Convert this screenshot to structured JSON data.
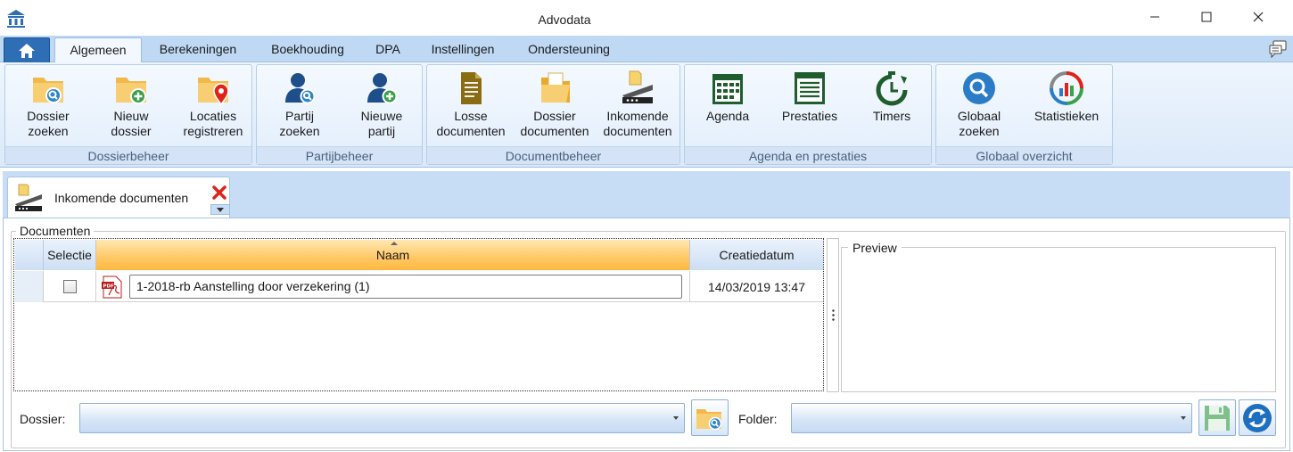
{
  "window": {
    "title": "Advodata",
    "minimize_icon": "minimize-icon",
    "maximize_icon": "maximize-icon",
    "close_icon": "close-icon"
  },
  "ribbon_tabs": [
    {
      "label": "Algemeen",
      "active": true
    },
    {
      "label": "Berekeningen",
      "active": false
    },
    {
      "label": "Boekhouding",
      "active": false
    },
    {
      "label": "DPA",
      "active": false
    },
    {
      "label": "Instellingen",
      "active": false
    },
    {
      "label": "Ondersteuning",
      "active": false
    }
  ],
  "groups": [
    {
      "label": "Dossierbeheer",
      "buttons": [
        {
          "line1": "Dossier",
          "line2": "zoeken",
          "icon": "folder-search-icon"
        },
        {
          "line1": "Nieuw",
          "line2": "dossier",
          "icon": "folder-add-icon"
        },
        {
          "line1": "Locaties",
          "line2": "registreren",
          "icon": "folder-location-icon"
        }
      ]
    },
    {
      "label": "Partijbeheer",
      "buttons": [
        {
          "line1": "Partij",
          "line2": "zoeken",
          "icon": "person-search-icon"
        },
        {
          "line1": "Nieuwe",
          "line2": "partij",
          "icon": "person-add-icon"
        }
      ]
    },
    {
      "label": "Documentbeheer",
      "buttons": [
        {
          "line1": "Losse",
          "line2": "documenten",
          "icon": "document-icon"
        },
        {
          "line1": "Dossier",
          "line2": "documenten",
          "icon": "folder-document-icon"
        },
        {
          "line1": "Inkomende",
          "line2": "documenten",
          "icon": "scanner-icon"
        }
      ]
    },
    {
      "label": "Agenda en prestaties",
      "buttons": [
        {
          "line1": "Agenda",
          "line2": "",
          "icon": "calendar-icon"
        },
        {
          "line1": "Prestaties",
          "line2": "",
          "icon": "list-icon"
        },
        {
          "line1": "Timers",
          "line2": "",
          "icon": "timer-icon"
        }
      ]
    },
    {
      "label": "Globaal overzicht",
      "buttons": [
        {
          "line1": "Globaal",
          "line2": "zoeken",
          "icon": "global-search-icon"
        },
        {
          "line1": "Statistieken",
          "line2": "",
          "icon": "statistics-icon"
        }
      ]
    }
  ],
  "doc_tab": {
    "label": "Inkomende documenten",
    "icon": "scanner-icon"
  },
  "documents": {
    "legend": "Documenten",
    "columns": [
      "Selectie",
      "Naam",
      "Creatiedatum"
    ],
    "rows": [
      {
        "selected": false,
        "name": "1-2018-rb Aanstelling door verzekering (1)",
        "date": "14/03/2019 13:47",
        "icon": "pdf-icon"
      }
    ]
  },
  "preview": {
    "legend": "Preview"
  },
  "bottom": {
    "dossier_label": "Dossier:",
    "dossier_value": "",
    "folder_label": "Folder:",
    "folder_value": "",
    "browse_icon": "folder-search-icon",
    "save_icon": "save-icon",
    "refresh_icon": "refresh-icon"
  },
  "colors": {
    "ribbon_bg": "#dbe9f9",
    "accent_blue": "#2e6eb5",
    "sorted_header": "#ffc864",
    "close_red": "#e0231a"
  }
}
